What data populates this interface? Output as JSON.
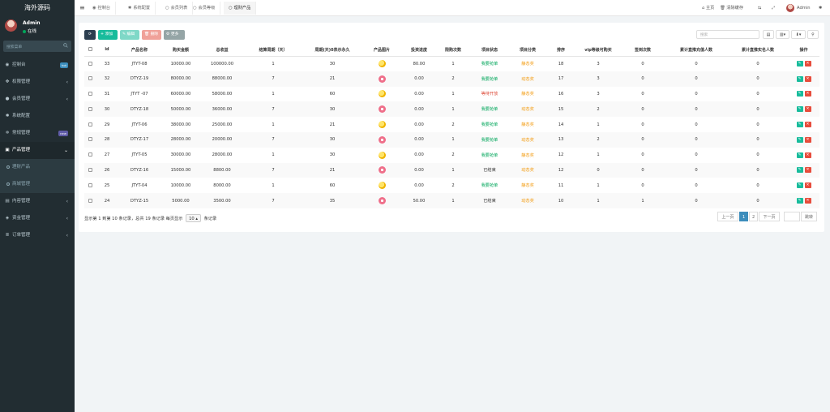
{
  "sidebar": {
    "brand": "海外源码",
    "user": {
      "name": "Admin",
      "status": "在线"
    },
    "search_placeholder": "搜索菜单",
    "items": [
      {
        "icon": "dashboard-icon",
        "glyph": "◉",
        "label": "控制台",
        "badge": "hot",
        "badge_color": "#3c8dbc"
      },
      {
        "icon": "users-icon",
        "glyph": "✤",
        "label": "权限管理",
        "caret": "‹"
      },
      {
        "icon": "member-icon",
        "glyph": "●",
        "label": "会员管理",
        "caret": "‹"
      },
      {
        "icon": "gear-icon",
        "glyph": "✱",
        "label": "系统配置"
      },
      {
        "icon": "cogs-icon",
        "glyph": "✲",
        "label": "常规管理",
        "badge": "new",
        "badge_color": "#605ca8"
      },
      {
        "icon": "product-icon",
        "glyph": "▣",
        "label": "产品管理",
        "caret": "⌄",
        "open": true
      },
      {
        "icon": "circle-icon",
        "label": "理财产品",
        "sub": true,
        "active": true
      },
      {
        "icon": "circle-icon",
        "label": "商城管理",
        "sub": true
      },
      {
        "icon": "content-icon",
        "glyph": "▤",
        "label": "内容管理",
        "caret": "‹"
      },
      {
        "icon": "funds-icon",
        "glyph": "◈",
        "label": "资金管理",
        "caret": "‹"
      },
      {
        "icon": "order-icon",
        "glyph": "≣",
        "label": "订单管理",
        "caret": "‹"
      }
    ]
  },
  "topnav": {
    "tabs": [
      {
        "label": "控制台",
        "glyph": "◉"
      },
      {
        "label": "系统配置",
        "glyph": "✱"
      },
      {
        "label": "会员列表",
        "glyph": "○"
      },
      {
        "label": "会员等级",
        "glyph": "○"
      },
      {
        "label": "理财产品",
        "glyph": "○",
        "active": true
      }
    ],
    "home": "主页",
    "clear_cache": "清除缓存",
    "admin": "Admin"
  },
  "toolbar": {
    "add": "+ 添加",
    "edit": "✎ 编辑",
    "delete": "🗑 删除",
    "more": "⚙ 更多",
    "search_placeholder": "搜索"
  },
  "colors": {
    "sidebar_bg": "#222d32",
    "primary": "#3c8dbc",
    "success": "#18bc9c",
    "danger": "#e74c3c"
  },
  "table": {
    "headers": [
      "",
      "id",
      "产品名称",
      "购买金额",
      "总收益",
      "结算周期（天）",
      "周期(天)0表示永久",
      "产品图片",
      "投资进度",
      "限购次数",
      "项目状态",
      "项目分类",
      "排序",
      "vip等级可购买",
      "签到次数",
      "累计直推充值人数",
      "累计直推实名人数",
      "操作"
    ],
    "rows": [
      {
        "id": "33",
        "name": "JTYT-08",
        "amount": "10000.00",
        "income": "100000.00",
        "settle": "1",
        "period": "30",
        "img": "a",
        "progress": "80.00",
        "limit": "1",
        "status": "我要抢单",
        "status_color": "green",
        "category": "静态奖",
        "sort": "18",
        "vip": "3",
        "checkin": "0",
        "recharge": "0",
        "realname": "0"
      },
      {
        "id": "32",
        "name": "DTYZ-19",
        "amount": "80000.00",
        "income": "88000.00",
        "settle": "7",
        "period": "21",
        "img": "b",
        "progress": "0.00",
        "limit": "2",
        "status": "我要抢单",
        "status_color": "green",
        "category": "动态奖",
        "sort": "17",
        "vip": "3",
        "checkin": "0",
        "recharge": "0",
        "realname": "0"
      },
      {
        "id": "31",
        "name": "JTYT -07",
        "amount": "60000.00",
        "income": "58000.00",
        "settle": "1",
        "period": "60",
        "img": "a",
        "progress": "0.00",
        "limit": "1",
        "status": "等待开放",
        "status_color": "red",
        "category": "静态奖",
        "sort": "16",
        "vip": "3",
        "checkin": "0",
        "recharge": "0",
        "realname": "0"
      },
      {
        "id": "30",
        "name": "DTYZ-18",
        "amount": "50000.00",
        "income": "36000.00",
        "settle": "7",
        "period": "30",
        "img": "b",
        "progress": "0.00",
        "limit": "1",
        "status": "我要抢单",
        "status_color": "green",
        "category": "动态奖",
        "sort": "15",
        "vip": "2",
        "checkin": "0",
        "recharge": "0",
        "realname": "0"
      },
      {
        "id": "29",
        "name": "JTYT-06",
        "amount": "38000.00",
        "income": "25000.00",
        "settle": "1",
        "period": "21",
        "img": "a",
        "progress": "0.00",
        "limit": "2",
        "status": "我要抢单",
        "status_color": "green",
        "category": "静态奖",
        "sort": "14",
        "vip": "1",
        "checkin": "0",
        "recharge": "0",
        "realname": "0"
      },
      {
        "id": "28",
        "name": "DTYZ-17",
        "amount": "28000.00",
        "income": "20000.00",
        "settle": "7",
        "period": "30",
        "img": "b",
        "progress": "0.00",
        "limit": "1",
        "status": "我要抢单",
        "status_color": "green",
        "category": "动态奖",
        "sort": "13",
        "vip": "2",
        "checkin": "0",
        "recharge": "0",
        "realname": "0"
      },
      {
        "id": "27",
        "name": "JTYT-05",
        "amount": "30000.00",
        "income": "28000.00",
        "settle": "1",
        "period": "30",
        "img": "a",
        "progress": "0.00",
        "limit": "2",
        "status": "我要抢单",
        "status_color": "green",
        "category": "静态奖",
        "sort": "12",
        "vip": "1",
        "checkin": "0",
        "recharge": "0",
        "realname": "0"
      },
      {
        "id": "26",
        "name": "DTYZ-16",
        "amount": "15000.00",
        "income": "8800.00",
        "settle": "7",
        "period": "21",
        "img": "b",
        "progress": "0.00",
        "limit": "1",
        "status": "已结束",
        "status_color": "default",
        "category": "动态奖",
        "sort": "12",
        "vip": "0",
        "checkin": "0",
        "recharge": "0",
        "realname": "0"
      },
      {
        "id": "25",
        "name": "JTYT-04",
        "amount": "10000.00",
        "income": "8000.00",
        "settle": "1",
        "period": "60",
        "img": "a",
        "progress": "0.00",
        "limit": "2",
        "status": "我要抢单",
        "status_color": "green",
        "category": "静态奖",
        "sort": "11",
        "vip": "1",
        "checkin": "0",
        "recharge": "0",
        "realname": "0"
      },
      {
        "id": "24",
        "name": "DTYZ-15",
        "amount": "5000.00",
        "income": "3500.00",
        "settle": "7",
        "period": "35",
        "img": "b",
        "progress": "50.00",
        "limit": "1",
        "status": "已结束",
        "status_color": "default",
        "category": "动态奖",
        "sort": "10",
        "vip": "1",
        "checkin": "1",
        "recharge": "0",
        "realname": "0"
      }
    ]
  },
  "footer": {
    "info_prefix": "显示第 1 到第 10 条记录，总共 19 条记录 每页显示",
    "page_size": "10 ▴",
    "info_suffix": "条记录",
    "prev": "上一页",
    "pages": [
      "1",
      "2"
    ],
    "next": "下一页",
    "jump": "跳转"
  }
}
